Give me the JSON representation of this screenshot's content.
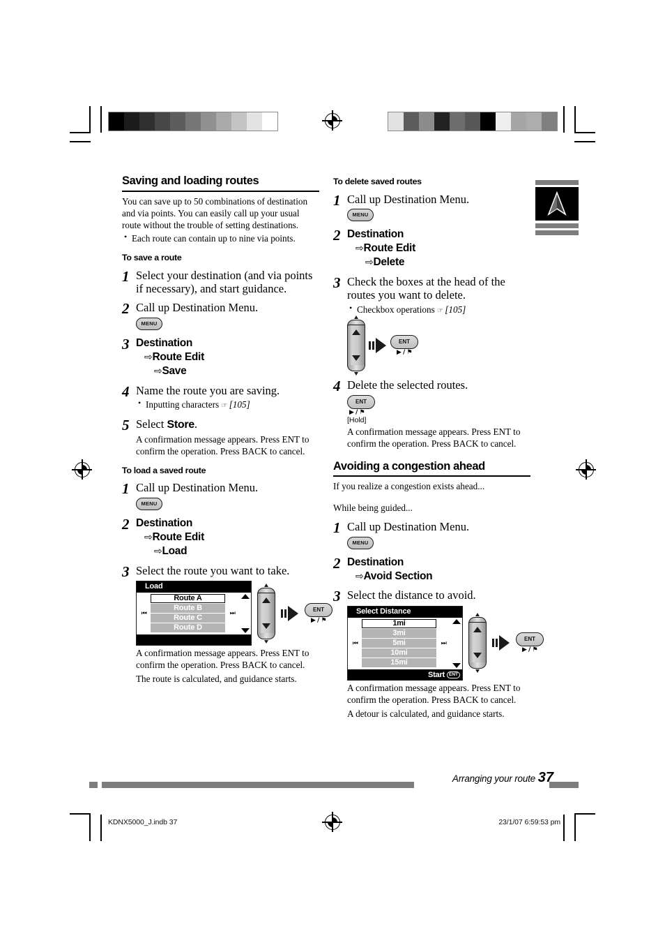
{
  "document": {
    "page_number": "37",
    "footer_section": "Arranging your route",
    "print_file": "KDNX5000_J.indb  37",
    "print_timestamp": "23/1/07   6:59:53 pm"
  },
  "left_column": {
    "section_title": "Saving and loading routes",
    "intro": "You can save up to 50 combinations of destination and via points. You can easily call up your usual route without the trouble of setting destinations.",
    "intro_bullet": "Each route can contain up to nine via points.",
    "save_subhead": "To save a route",
    "save_steps": [
      {
        "num": "1",
        "text": "Select your destination (and via points if necessary), and start guidance."
      },
      {
        "num": "2",
        "text": "Call up Destination Menu.",
        "button": "MENU"
      },
      {
        "num": "3",
        "menu": [
          "Destination",
          "Route Edit",
          "Save"
        ]
      },
      {
        "num": "4",
        "text": "Name the route you are saving.",
        "bullet": "Inputting characters",
        "bullet_ref": "[105]"
      },
      {
        "num": "5",
        "text_pre": "Select ",
        "keyword": "Store",
        "text_post": ".",
        "note": "A confirmation message appears. Press ENT to confirm the operation. Press BACK to cancel."
      }
    ],
    "load_subhead": "To load a saved route",
    "load_steps": [
      {
        "num": "1",
        "text": "Call up Destination Menu.",
        "button": "MENU"
      },
      {
        "num": "2",
        "menu": [
          "Destination",
          "Route Edit",
          "Load"
        ]
      },
      {
        "num": "3",
        "text": "Select the route you want to take."
      }
    ],
    "load_screen": {
      "title": "Load",
      "items": [
        "Route A",
        "Route B",
        "Route C",
        "Route D"
      ],
      "selected_index": 0,
      "prev_icon": "skip-previous-icon",
      "next_icon": "skip-next-icon",
      "scroll_up_icon": "triangle-up-icon",
      "scroll_down_icon": "triangle-down-icon"
    },
    "load_note": "A confirmation message appears. Press ENT to confirm the operation. Press BACK to cancel.",
    "load_note2": "The route is calculated, and guidance starts."
  },
  "right_column": {
    "delete_subhead": "To delete saved routes",
    "delete_steps": [
      {
        "num": "1",
        "text": "Call up Destination Menu.",
        "button": "MENU"
      },
      {
        "num": "2",
        "menu": [
          "Destination",
          "Route Edit",
          "Delete"
        ]
      },
      {
        "num": "3",
        "text": "Check the boxes at the head of the routes you want to delete.",
        "bullet": "Checkbox operations",
        "bullet_ref": "[105]"
      },
      {
        "num": "4",
        "text": "Delete the selected routes.",
        "button": "ENT",
        "button_sub": "▶ / ⚑",
        "hold": "[Hold]",
        "note": "A confirmation message appears. Press ENT to confirm the operation. Press BACK to cancel."
      }
    ],
    "section_title": "Avoiding a congestion ahead",
    "intro": "If you realize a congestion exists ahead...",
    "precondition": "While being guided...",
    "avoid_steps": [
      {
        "num": "1",
        "text": "Call up Destination Menu.",
        "button": "MENU"
      },
      {
        "num": "2",
        "menu": [
          "Destination",
          "Avoid Section"
        ]
      },
      {
        "num": "3",
        "text": "Select the distance to avoid."
      }
    ],
    "distance_screen": {
      "title": "Select Distance",
      "items": [
        "1mi",
        "3mi",
        "5mi",
        "10mi",
        "15mi"
      ],
      "selected_index": 0,
      "footer_label": "Start",
      "footer_chip": "ENT",
      "prev_icon": "skip-previous-icon",
      "next_icon": "skip-next-icon"
    },
    "avoid_note": "A confirmation message appears. Press ENT to confirm the operation. Press BACK to cancel.",
    "avoid_note2": "A detour is calculated, and guidance starts."
  },
  "controls": {
    "menu_button_label": "MENU",
    "ent_button_label": "ENT",
    "ent_button_sub": "▶ / ⚑"
  },
  "calibration": {
    "left_bar": [
      "#000000",
      "#1c1c1c",
      "#303030",
      "#474747",
      "#5d5d5d",
      "#777777",
      "#909090",
      "#aaaaaa",
      "#c4c4c4",
      "#e3e3e3",
      "#ffffff"
    ],
    "right_bar": [
      "#e2e2e2",
      "#5c5c5c",
      "#8c8c8c",
      "#222222",
      "#6d6d6d",
      "#585858",
      "#000000",
      "#efefef",
      "#a6a6a6",
      "#adadad",
      "#808080"
    ]
  }
}
